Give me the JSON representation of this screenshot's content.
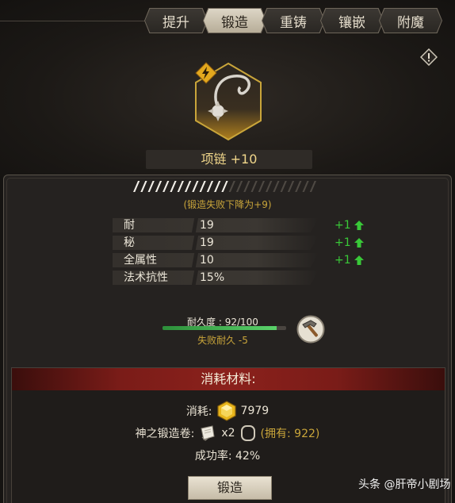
{
  "tabs": [
    {
      "label": "提升",
      "active": false
    },
    {
      "label": "锻造",
      "active": true
    },
    {
      "label": "重铸",
      "active": false
    },
    {
      "label": "镶嵌",
      "active": false
    },
    {
      "label": "附魔",
      "active": false
    }
  ],
  "item": {
    "name": "项链 +10",
    "icon": "necklace-icon",
    "badge_icon": "lightning-icon"
  },
  "forge_progress": {
    "filled_segments": 13,
    "total_segments": 25
  },
  "fail_note": "(锻造失败下降为+9)",
  "stats": [
    {
      "name": "耐",
      "value": "19",
      "bonus": "+1"
    },
    {
      "name": "秘",
      "value": "19",
      "bonus": "+1"
    },
    {
      "name": "全属性",
      "value": "10",
      "bonus": "+1"
    },
    {
      "name": "法术抗性",
      "value": "15%",
      "bonus": ""
    }
  ],
  "durability": {
    "label": "耐久度 : 92/100",
    "current": 92,
    "max": 100,
    "fail_text": "失败耐久 -5"
  },
  "materials": {
    "header": "消耗材料:",
    "cost_label": "消耗:",
    "cost_value": "7979",
    "scroll_label": "神之锻造卷:",
    "scroll_count": "x2",
    "owned_text": "(拥有: 922)",
    "success_label": "成功率: 42%"
  },
  "forge_button": "锻造",
  "watermark": "头条 @肝帝小剧场",
  "colors": {
    "accent_gold": "#c9a53a",
    "bonus_green": "#39c838",
    "header_red": "#8b211c"
  }
}
